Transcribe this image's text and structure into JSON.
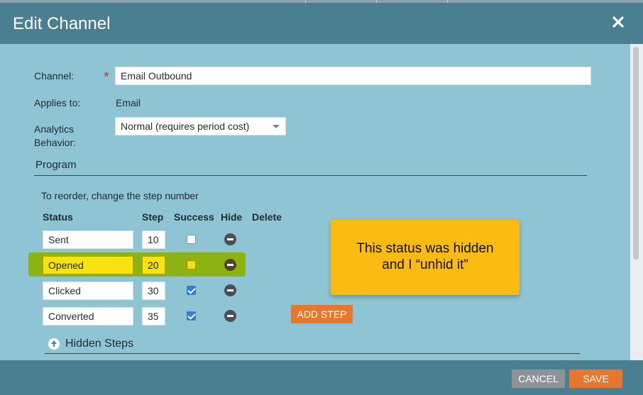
{
  "dialog": {
    "title": "Edit Channel",
    "close_icon": "close-icon"
  },
  "form": {
    "channel_label": "Channel:",
    "required_mark": "*",
    "channel_value": "Email Outbound",
    "applies_label": "Applies to:",
    "applies_value": "Email",
    "analytics_label_line1": "Analytics",
    "analytics_label_line2": "Behavior:",
    "analytics_value": "Normal (requires period cost)"
  },
  "program": {
    "section_title": "Program",
    "reorder_hint": "To reorder, change the step number",
    "columns": {
      "status": "Status",
      "step": "Step",
      "success": "Success",
      "hide": "Hide",
      "delete": "Delete"
    },
    "rows": [
      {
        "status": "Sent",
        "step": "10",
        "success": false,
        "highlighted": false
      },
      {
        "status": "Opened",
        "step": "20",
        "success": false,
        "highlighted": true
      },
      {
        "status": "Clicked",
        "step": "30",
        "success": true,
        "highlighted": false
      },
      {
        "status": "Converted",
        "step": "35",
        "success": true,
        "highlighted": false
      }
    ],
    "add_step_label": "ADD STEP",
    "hidden_steps_label": "Hidden Steps"
  },
  "callout": {
    "text_line1": "This status was hidden",
    "text_line2": "and I “unhid it”"
  },
  "footer": {
    "cancel_label": "CANCEL",
    "save_label": "SAVE"
  },
  "colors": {
    "header": "#4a7f91",
    "body": "#8ec4d3",
    "accent": "#e8772e",
    "highlight": "#8db312",
    "callout": "#fbbb10"
  }
}
